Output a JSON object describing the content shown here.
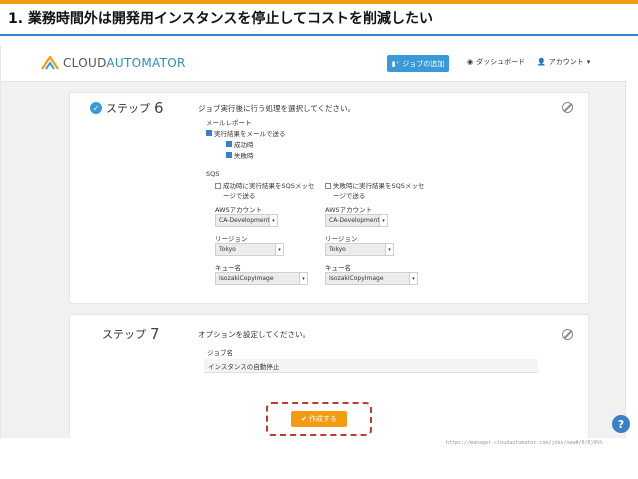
{
  "slide": {
    "title": "1. 業務時間外は開発用インスタンスを停止してコストを削減したい"
  },
  "navbar": {
    "logo": {
      "part1": "CLOUD",
      "part2": "AUTOMATOR"
    },
    "add_job": "ジョブの追加",
    "dashboard": "ダッシュボード",
    "account": "アカウント"
  },
  "step6": {
    "label": "ステップ",
    "number": "6",
    "description": "ジョブ実行後に行う処理を選択してください。",
    "mail_report": {
      "heading": "メールレポート",
      "send_results": "実行結果をメールで送る",
      "on_success": "成功時",
      "on_failure": "失敗時"
    },
    "sqs": {
      "heading": "SQS",
      "success_option": "成功時に実行結果をSQSメッセージで送る",
      "failure_option": "失敗時に実行結果をSQSメッセージで送る",
      "aws_account_label": "AWSアカウント",
      "region_label": "リージョン",
      "queue_label": "キュー名",
      "success": {
        "aws_account": "CA-Development",
        "region": "Tokyo",
        "queue": "IsozakiCopyImage"
      },
      "failure": {
        "aws_account": "CA-Development",
        "region": "Tokyo",
        "queue": "IsozakiCopyImage"
      }
    }
  },
  "step7": {
    "label": "ステップ",
    "number": "7",
    "description": "オプションを設定してください。",
    "job_name_label": "ジョブ名",
    "job_name_value": "インスタンスの自動停止"
  },
  "create_button": "作成する",
  "help": "?",
  "url": "https://manager.cloudautomator.com/jobs/new#/0/0)9%%",
  "colors": {
    "accent": "#3a9ad9",
    "orange": "#f39c12",
    "highlight": "#c0392b"
  }
}
